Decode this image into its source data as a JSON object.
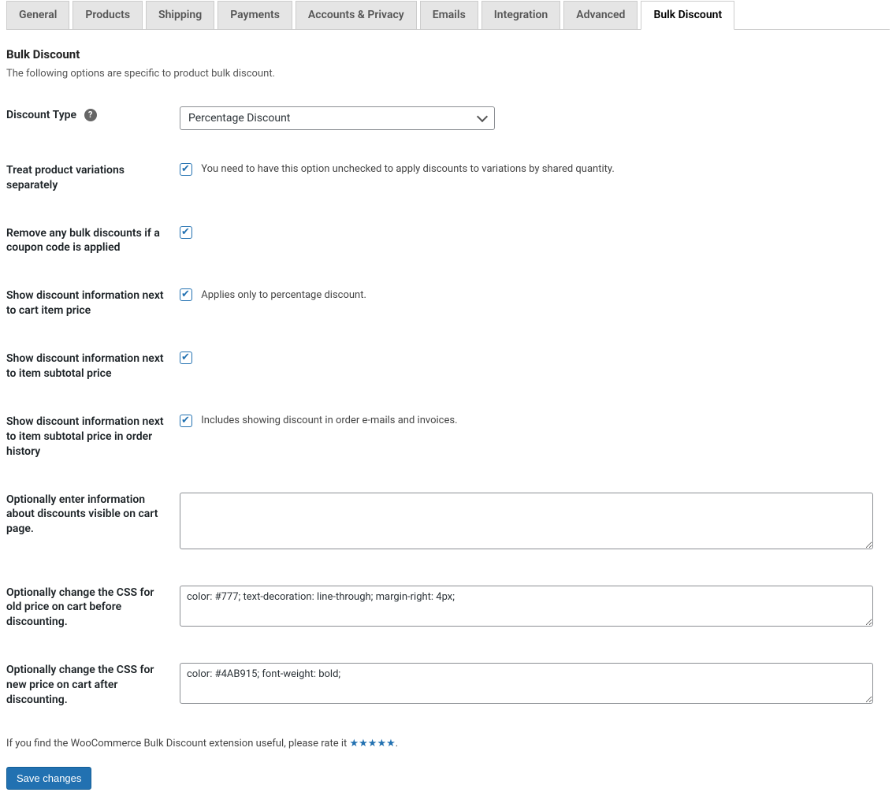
{
  "tabs": [
    {
      "label": "General",
      "active": false
    },
    {
      "label": "Products",
      "active": false
    },
    {
      "label": "Shipping",
      "active": false
    },
    {
      "label": "Payments",
      "active": false
    },
    {
      "label": "Accounts & Privacy",
      "active": false
    },
    {
      "label": "Emails",
      "active": false
    },
    {
      "label": "Integration",
      "active": false
    },
    {
      "label": "Advanced",
      "active": false
    },
    {
      "label": "Bulk Discount",
      "active": true
    }
  ],
  "heading": "Bulk Discount",
  "description": "The following options are specific to product bulk discount.",
  "fields": {
    "discount_type": {
      "label": "Discount Type",
      "value": "Percentage Discount"
    },
    "treat_variations": {
      "label": "Treat product variations separately",
      "checked": true,
      "desc": "You need to have this option unchecked to apply discounts to variations by shared quantity."
    },
    "remove_on_coupon": {
      "label": "Remove any bulk discounts if a coupon code is applied",
      "checked": true,
      "desc": ""
    },
    "show_next_cart": {
      "label": "Show discount information next to cart item price",
      "checked": true,
      "desc": "Applies only to percentage discount."
    },
    "show_next_subtotal": {
      "label": "Show discount information next to item subtotal price",
      "checked": true,
      "desc": ""
    },
    "show_next_subtotal_history": {
      "label": "Show discount information next to item subtotal price in order history",
      "checked": true,
      "desc": "Includes showing discount in order e-mails and invoices."
    },
    "cart_info": {
      "label": "Optionally enter information about discounts visible on cart page.",
      "value": ""
    },
    "css_old": {
      "label": "Optionally change the CSS for old price on cart before discounting.",
      "value": "color: #777; text-decoration: line-through; margin-right: 4px;"
    },
    "css_new": {
      "label": "Optionally change the CSS for new price on cart after discounting.",
      "value": "color: #4AB915; font-weight: bold;"
    }
  },
  "rate_prefix": "If you find the WooCommerce Bulk Discount extension useful, please rate it ",
  "rate_stars": "★★★★★",
  "rate_suffix": ".",
  "save_label": "Save changes"
}
